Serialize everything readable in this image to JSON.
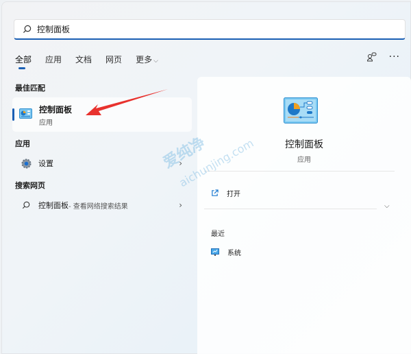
{
  "search": {
    "value": "控制面板"
  },
  "tabs": [
    {
      "label": "全部",
      "active": true
    },
    {
      "label": "应用"
    },
    {
      "label": "文档"
    },
    {
      "label": "网页"
    },
    {
      "label": "更多"
    }
  ],
  "best_match": {
    "heading": "最佳匹配",
    "title": "控制面板",
    "subtitle": "应用"
  },
  "apps": {
    "heading": "应用",
    "items": [
      {
        "label": "设置"
      }
    ]
  },
  "web": {
    "heading": "搜索网页",
    "query": "控制面板",
    "suffix": " - 查看网络搜索结果"
  },
  "detail": {
    "title": "控制面板",
    "subtitle": "应用",
    "actions": [
      {
        "label": "打开"
      }
    ],
    "recent_heading": "最近",
    "recent": [
      {
        "label": "系统"
      }
    ]
  },
  "watermark": {
    "cn": "爱纯净",
    "url": "aichunjing.com"
  },
  "colors": {
    "accent": "#1a5fb4",
    "arrow": "#e8322e"
  }
}
